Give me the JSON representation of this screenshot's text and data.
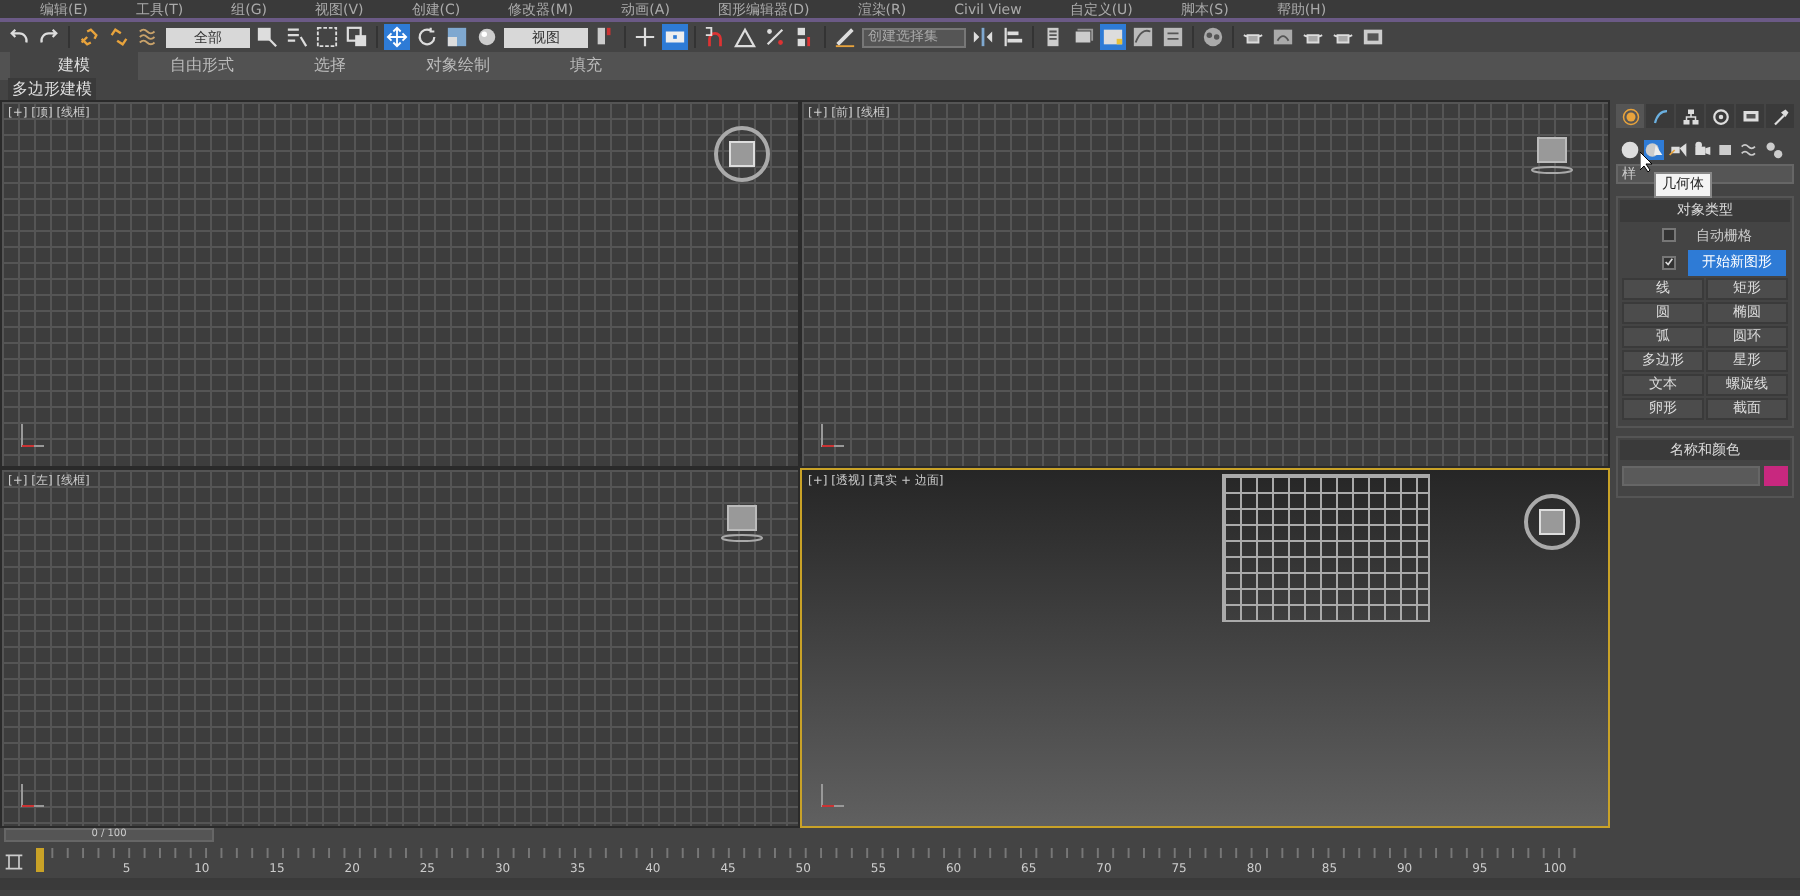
{
  "menu_bar": [
    "编辑(E)",
    "工具(T)",
    "组(G)",
    "视图(V)",
    "创建(C)",
    "修改器(M)",
    "动画(A)",
    "图形编辑器(D)",
    "渲染(R)",
    "Civil View",
    "自定义(U)",
    "脚本(S)",
    "帮助(H)"
  ],
  "toolbar": [
    {
      "kind": "undo",
      "selected": false
    },
    {
      "kind": "redo",
      "selected": false
    },
    {
      "kind": "sep"
    },
    {
      "kind": "link",
      "selected": false
    },
    {
      "kind": "unlink",
      "selected": false
    },
    {
      "kind": "bind",
      "selected": false
    },
    {
      "kind": "dropdown",
      "value": "全部"
    },
    {
      "kind": "select",
      "selected": false
    },
    {
      "kind": "select-list",
      "selected": false
    },
    {
      "kind": "rect-region",
      "selected": false
    },
    {
      "kind": "crossing",
      "selected": false
    },
    {
      "kind": "sep"
    },
    {
      "kind": "move",
      "selected": true
    },
    {
      "kind": "rotate",
      "selected": false
    },
    {
      "kind": "scale",
      "selected": false
    },
    {
      "kind": "sphere",
      "selected": false
    },
    {
      "kind": "dropdown",
      "value": "视图"
    },
    {
      "kind": "pivot",
      "selected": false
    },
    {
      "kind": "sep"
    },
    {
      "kind": "manipulate",
      "selected": false
    },
    {
      "kind": "keyboard",
      "selected": true
    },
    {
      "kind": "sep"
    },
    {
      "kind": "snap",
      "selected": false
    },
    {
      "kind": "angle-snap",
      "selected": false
    },
    {
      "kind": "percent-snap",
      "selected": false
    },
    {
      "kind": "spinner-snap",
      "selected": false
    },
    {
      "kind": "sep"
    },
    {
      "kind": "pencil",
      "selected": false
    },
    {
      "kind": "field",
      "placeholder": "创建选择集"
    },
    {
      "kind": "mirror",
      "selected": false
    },
    {
      "kind": "align",
      "selected": false
    },
    {
      "kind": "sep"
    },
    {
      "kind": "layers",
      "selected": false
    },
    {
      "kind": "stack",
      "selected": false
    },
    {
      "kind": "ribbon",
      "selected": true
    },
    {
      "kind": "curve",
      "selected": false
    },
    {
      "kind": "schematic",
      "selected": false
    },
    {
      "kind": "sep"
    },
    {
      "kind": "material",
      "selected": false
    },
    {
      "kind": "sep"
    },
    {
      "kind": "teapot",
      "selected": false
    },
    {
      "kind": "frame",
      "selected": false
    },
    {
      "kind": "teapot",
      "selected": false
    },
    {
      "kind": "teapot",
      "selected": false
    },
    {
      "kind": "render",
      "selected": false
    }
  ],
  "ribbon_tabs": [
    {
      "label": "建模",
      "selected": true
    },
    {
      "label": "自由形式",
      "selected": false
    },
    {
      "label": "选择",
      "selected": false
    },
    {
      "label": "对象绘制",
      "selected": false
    },
    {
      "label": "填充",
      "selected": false
    }
  ],
  "ribbon_panel": "多边形建模",
  "viewports": [
    {
      "label": "[+] [顶] [线框]",
      "kind": "ortho",
      "active": false
    },
    {
      "label": "[+] [前] [线框]",
      "kind": "ortho",
      "active": false
    },
    {
      "label": "[+] [左] [线框]",
      "kind": "ortho",
      "active": false
    },
    {
      "label": "[+] [透视] [真实 + 边面]",
      "kind": "perspective",
      "active": true
    }
  ],
  "command_panel": {
    "tabs": [
      {
        "kind": "create",
        "selected": true
      },
      {
        "kind": "modify",
        "selected": false
      },
      {
        "kind": "hierarchy",
        "selected": false
      },
      {
        "kind": "motion",
        "selected": false
      },
      {
        "kind": "display",
        "selected": false
      },
      {
        "kind": "utilities",
        "selected": false
      }
    ],
    "categories": [
      {
        "kind": "geometry",
        "selected": false
      },
      {
        "kind": "shapes",
        "selected": true
      },
      {
        "kind": "lights",
        "selected": false
      },
      {
        "kind": "cameras",
        "selected": false
      },
      {
        "kind": "helpers",
        "selected": false
      },
      {
        "kind": "spacewarps",
        "selected": false
      },
      {
        "kind": "systems",
        "selected": false
      }
    ],
    "tooltip": "几何体",
    "dropdown": "样",
    "object_type": {
      "title": "对象类型",
      "checks": [
        {
          "label": "自动栅格",
          "checked": false
        },
        {
          "label": "开始新图形",
          "checked": true
        }
      ],
      "buttons": [
        {
          "label": "线",
          "selected": false
        },
        {
          "label": "矩形",
          "selected": false
        },
        {
          "label": "圆",
          "selected": false
        },
        {
          "label": "椭圆",
          "selected": false
        },
        {
          "label": "弧",
          "selected": false
        },
        {
          "label": "圆环",
          "selected": false
        },
        {
          "label": "多边形",
          "selected": false
        },
        {
          "label": "星形",
          "selected": false
        },
        {
          "label": "文本",
          "selected": false
        },
        {
          "label": "螺旋线",
          "selected": false
        },
        {
          "label": "卵形",
          "selected": false
        },
        {
          "label": "截面",
          "selected": false
        }
      ]
    },
    "name_and_color": {
      "title": "名称和颜色",
      "color": "#c8287f"
    }
  },
  "timeline": {
    "slider": "0 / 100",
    "level": 0.0,
    "ticks": [
      "5",
      "10",
      "15",
      "20",
      "25",
      "30",
      "35",
      "40",
      "45",
      "50",
      "55",
      "60",
      "65",
      "70",
      "75",
      "80",
      "85",
      "90",
      "95",
      "100"
    ]
  }
}
